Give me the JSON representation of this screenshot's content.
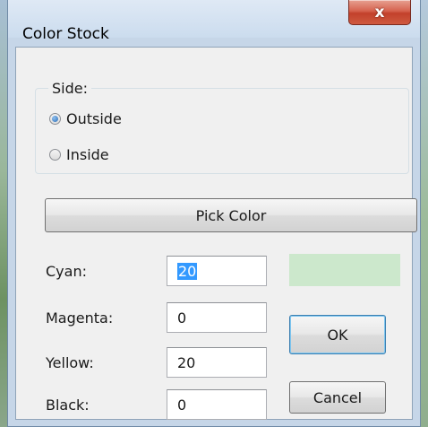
{
  "window": {
    "title": "Color Stock",
    "close_glyph": "x"
  },
  "side_group": {
    "label": "Side:",
    "options": [
      {
        "label": "Outside",
        "checked": true
      },
      {
        "label": "Inside",
        "checked": false
      }
    ]
  },
  "pick_color_label": "Pick Color",
  "fields": {
    "cyan": {
      "label": "Cyan:",
      "value": "20"
    },
    "magenta": {
      "label": "Magenta:",
      "value": "0"
    },
    "yellow": {
      "label": "Yellow:",
      "value": "20"
    },
    "black": {
      "label": "Black:",
      "value": "0"
    }
  },
  "color_preview": "#cce8cc",
  "buttons": {
    "ok": "OK",
    "cancel": "Cancel"
  }
}
